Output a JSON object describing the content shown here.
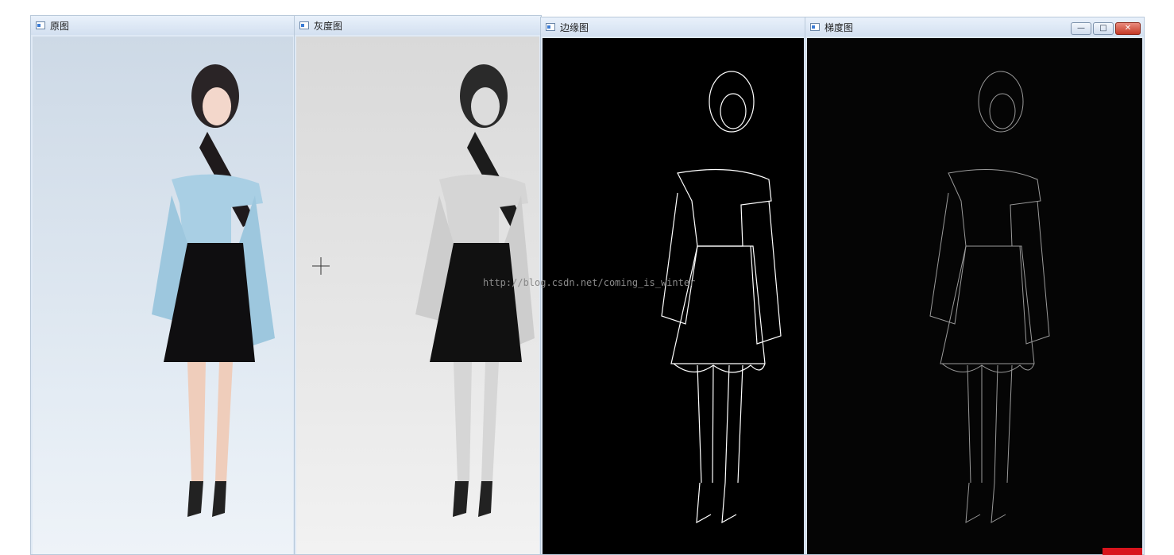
{
  "windows": [
    {
      "id": "original",
      "title": "原图",
      "image": "color-photo"
    },
    {
      "id": "gray",
      "title": "灰度图",
      "image": "grayscale-photo"
    },
    {
      "id": "edges",
      "title": "边缘图",
      "image": "edge-map"
    },
    {
      "id": "gradient",
      "title": "梯度图",
      "image": "gradient-map"
    }
  ],
  "watermark": "http://blog.csdn.net/coming_is_winter",
  "window_controls": {
    "minimize": "—",
    "maximize": "□",
    "close": "✕"
  },
  "colors": {
    "titlebar": "#d3e0f0",
    "photo_bg": "#dde6f0",
    "gray_bg": "#ececec",
    "edge_bg": "#000000",
    "close": "#c43a27"
  }
}
